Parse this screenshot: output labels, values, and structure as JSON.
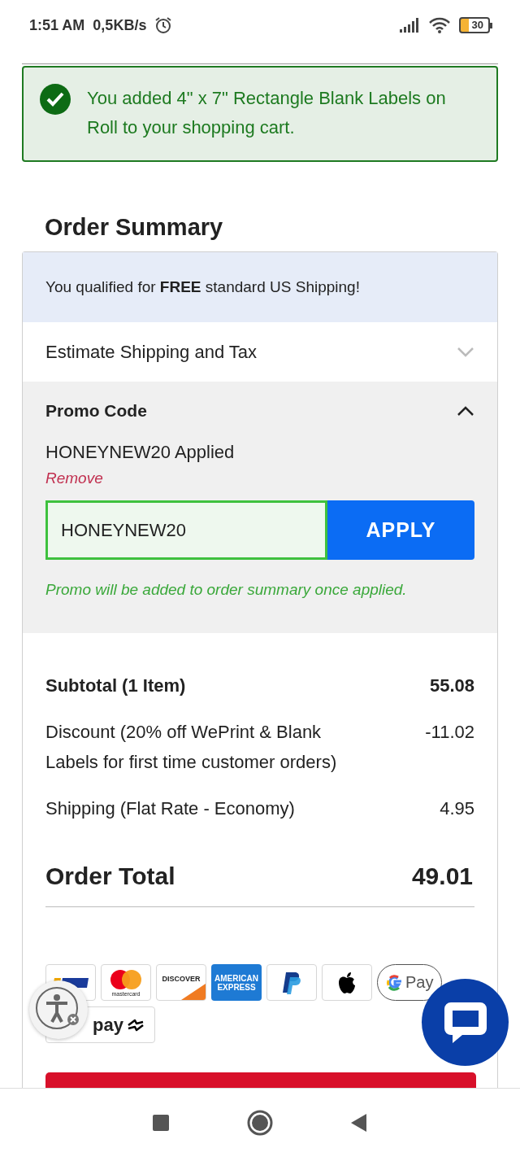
{
  "status_bar": {
    "time": "1:51 AM",
    "speed": "0,5KB/s",
    "battery": "30"
  },
  "alert": {
    "message": "You added 4\" x 7\" Rectangle Blank Labels on Roll to your shopping cart."
  },
  "order_summary": {
    "title": "Order Summary",
    "banner": "You qualified for **FREE** standard US Shipping!",
    "estimate": {
      "label": "Estimate Shipping and Tax",
      "expanded": false
    },
    "promo": {
      "title": "Promo Code",
      "expanded": true,
      "applied": "HONEYNEW20 Applied",
      "remove": "Remove",
      "value": "HONEYNEW20",
      "button": "APPLY",
      "hint": "Promo will be added to order summary once applied."
    },
    "lines": [
      {
        "kind": "subtotal",
        "label": "Subtotal (1 Item)",
        "value": "55.08"
      },
      {
        "kind": "line",
        "label": "Discount (20% off WePrint & Blank Labels for first time customer orders)",
        "value": "-11.02"
      },
      {
        "kind": "line",
        "label": "Shipping (Flat Rate - Economy)",
        "value": "4.95"
      }
    ],
    "total": {
      "label": "Order Total",
      "value": "49.01"
    },
    "payment_methods": [
      {
        "kind": "visa"
      },
      {
        "kind": "mastercard",
        "label": "mastercard"
      },
      {
        "kind": "discover",
        "label": "DISCOVER"
      },
      {
        "kind": "amex",
        "label": "AMERICAN EXPRESS"
      },
      {
        "kind": "paypal"
      },
      {
        "kind": "apple"
      },
      {
        "kind": "gpay",
        "label": "Pay"
      },
      {
        "kind": "afterpay",
        "label": "pay"
      }
    ]
  }
}
